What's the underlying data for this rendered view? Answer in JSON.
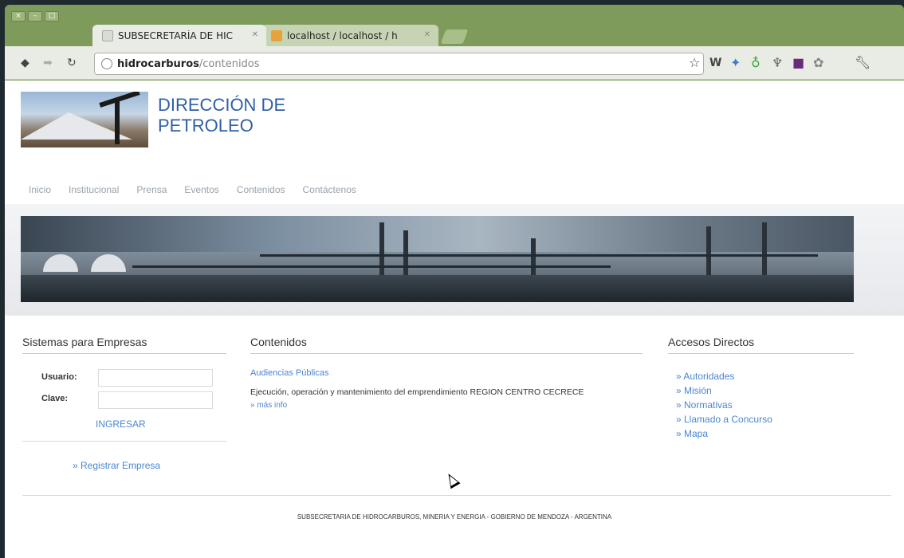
{
  "window": {
    "buttons": [
      "×",
      "–",
      "□"
    ]
  },
  "tabs": [
    {
      "title": "SUBSECRETARÍA DE HIC",
      "active": true
    },
    {
      "title": "localhost / localhost / h",
      "active": false
    }
  ],
  "toolbar": {
    "url_host": "hidrocarburos",
    "url_path": "/contenidos",
    "extensions": [
      "star-icon",
      "w-icon",
      "puzzle-icon",
      "leaf-icon",
      "shield-icon",
      "book-icon",
      "settings-icon",
      "wrench-icon"
    ]
  },
  "site": {
    "title_line1": "DIRECCIÓN DE",
    "title_line2": "PETROLEO",
    "menu": [
      "Inicio",
      "Institucional",
      "Prensa",
      "Eventos",
      "Contenidos",
      "Contáctenos"
    ]
  },
  "left": {
    "heading": "Sistemas para Empresas",
    "user_label": "Usuario:",
    "pass_label": "Clave:",
    "submit": "INGRESAR",
    "register": "» Registrar Empresa"
  },
  "center": {
    "heading": "Contenidos",
    "item_title": "Audiencias Públicas",
    "item_text": "Ejecución, operación y mantenimiento del emprendimiento REGION CENTRO CECRECE",
    "more": "» más info"
  },
  "right": {
    "heading": "Accesos Directos",
    "links": [
      "» Autoridades",
      "» Misión",
      "» Normativas",
      "» Llamado a Concurso",
      "» Mapa"
    ]
  },
  "footer": "SUBSECRETARIA DE HIDROCARBUROS, MINERIA Y ENERGIA - GOBIERNO DE MENDOZA - ARGENTINA"
}
